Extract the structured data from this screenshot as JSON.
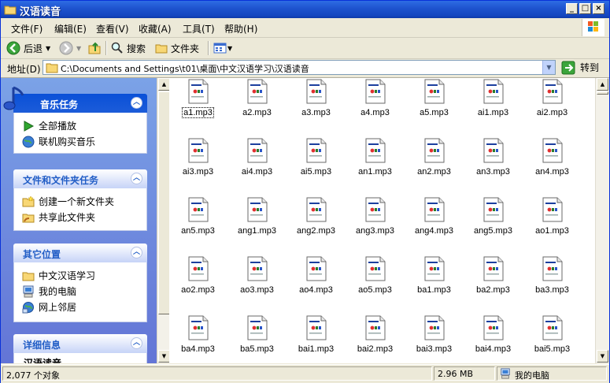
{
  "window": {
    "title": "汉语读音"
  },
  "menu": [
    "文件(F)",
    "编辑(E)",
    "查看(V)",
    "收藏(A)",
    "工具(T)",
    "帮助(H)"
  ],
  "toolbar": {
    "back": "后退",
    "search": "搜索",
    "folders": "文件夹"
  },
  "address": {
    "label": "地址(D)",
    "path": "C:\\Documents and Settings\\t01\\桌面\\中文汉语学习\\汉语读音",
    "go": "转到"
  },
  "panels": {
    "music": {
      "title": "音乐任务",
      "items": [
        "全部播放",
        "联机购买音乐"
      ]
    },
    "file_tasks": {
      "title": "文件和文件夹任务",
      "items": [
        "创建一个新文件夹",
        "共享此文件夹"
      ]
    },
    "places": {
      "title": "其它位置",
      "items": [
        "中文汉语学习",
        "我的电脑",
        "网上邻居"
      ]
    },
    "details": {
      "title": "详细信息",
      "sub": "汉语读音"
    }
  },
  "files": [
    "a1.mp3",
    "a2.mp3",
    "a3.mp3",
    "a4.mp3",
    "a5.mp3",
    "ai1.mp3",
    "ai2.mp3",
    "ai3.mp3",
    "ai4.mp3",
    "ai5.mp3",
    "an1.mp3",
    "an2.mp3",
    "an3.mp3",
    "an4.mp3",
    "an5.mp3",
    "ang1.mp3",
    "ang2.mp3",
    "ang3.mp3",
    "ang4.mp3",
    "ang5.mp3",
    "ao1.mp3",
    "ao2.mp3",
    "ao3.mp3",
    "ao4.mp3",
    "ao5.mp3",
    "ba1.mp3",
    "ba2.mp3",
    "ba3.mp3",
    "ba4.mp3",
    "ba5.mp3",
    "bai1.mp3",
    "bai2.mp3",
    "bai3.mp3",
    "bai4.mp3",
    "bai5.mp3"
  ],
  "status": {
    "count": "2,077 个对象",
    "size": "2.96 MB",
    "location": "我的电脑"
  }
}
